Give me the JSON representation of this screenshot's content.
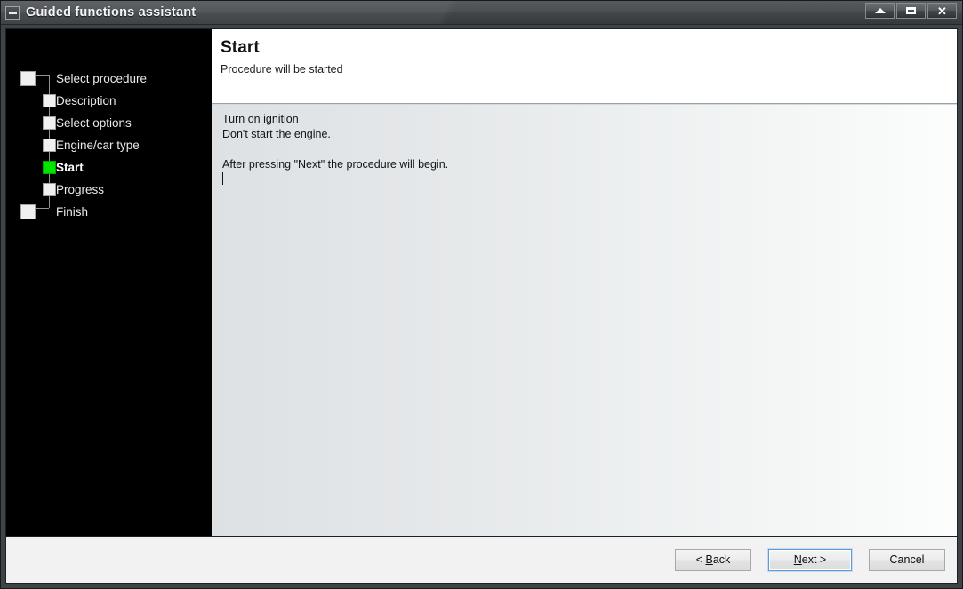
{
  "window": {
    "title": "Guided functions assistant",
    "sysmenu_icon": "window-menu-icon",
    "controls": [
      {
        "name": "rollup-button",
        "icon": "triangle-up-icon",
        "label": ""
      },
      {
        "name": "restore-button",
        "icon": "restore-window-icon",
        "label": ""
      },
      {
        "name": "close-button",
        "icon": "close-x-icon",
        "label": "✕"
      }
    ]
  },
  "sidebar": {
    "steps": [
      {
        "label": "Select procedure",
        "level": "root",
        "state": "pending"
      },
      {
        "label": "Description",
        "level": "child",
        "state": "pending"
      },
      {
        "label": "Select options",
        "level": "child",
        "state": "pending"
      },
      {
        "label": "Engine/car type",
        "level": "child",
        "state": "pending"
      },
      {
        "label": "Start",
        "level": "child",
        "state": "current"
      },
      {
        "label": "Progress",
        "level": "child",
        "state": "pending"
      },
      {
        "label": "Finish",
        "level": "root",
        "state": "pending"
      }
    ],
    "colors": {
      "background": "#000000",
      "current_marker": "#00e400",
      "pending_marker": "#f0f0f0",
      "connector": "#8e9498",
      "label": "#eceae6"
    }
  },
  "pane": {
    "title": "Start",
    "subtitle": "Procedure will be started",
    "lines": [
      "Turn on ignition",
      "Don't start the engine.",
      "",
      "After pressing \"Next\" the procedure will begin."
    ],
    "caret_visible": true
  },
  "footer": {
    "buttons": [
      {
        "name": "back-button",
        "text_before": "< ",
        "mnemonic": "B",
        "text_after": "ack",
        "focused": false
      },
      {
        "name": "next-button",
        "text_before": "",
        "mnemonic": "N",
        "text_after": "ext >",
        "focused": true
      },
      {
        "name": "cancel-button",
        "text_before": "",
        "mnemonic": "",
        "text_after": "Cancel",
        "focused": false
      }
    ],
    "focus_color": "#5f9ad8"
  }
}
